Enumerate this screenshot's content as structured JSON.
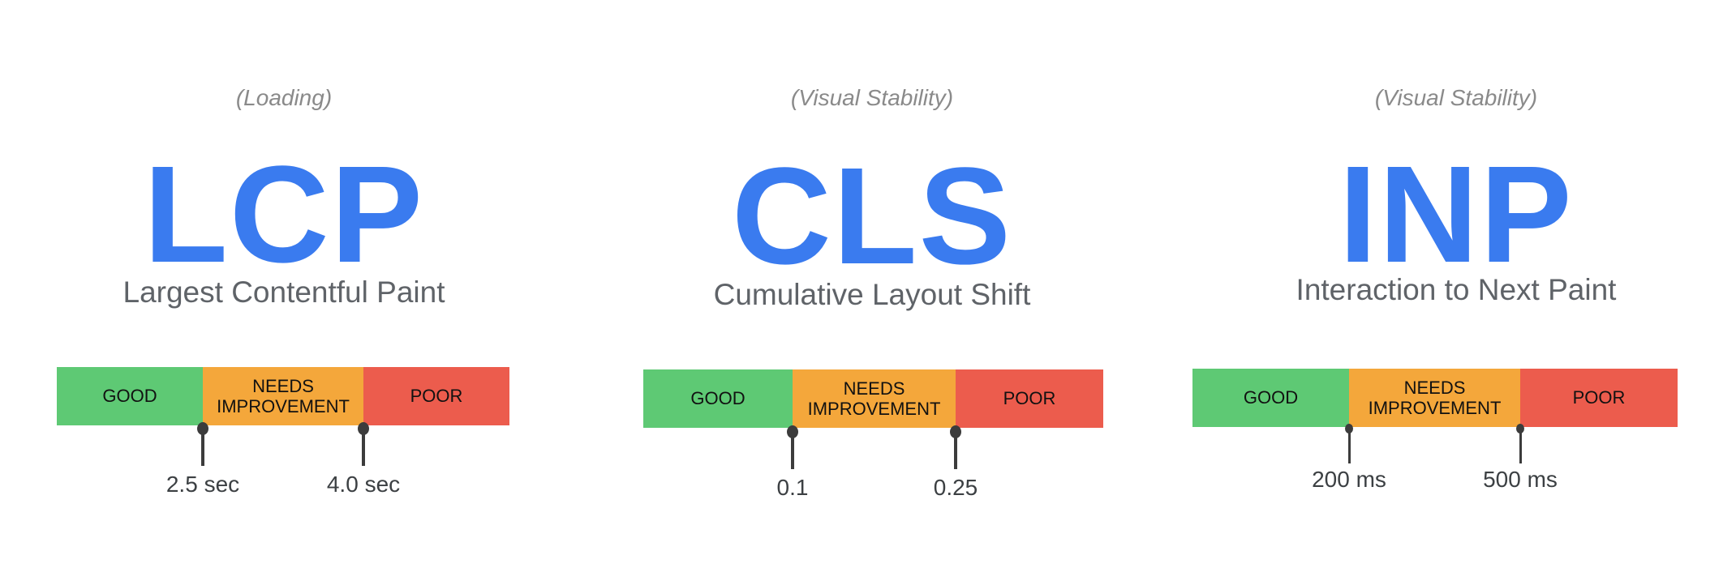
{
  "colors": {
    "accent": "#3a7bef",
    "good": "#5ec974",
    "needs_improvement": "#f4a73b",
    "poor": "#ec5c4d",
    "marker": "#3c3c3c",
    "category_text": "#8a8a8a",
    "name_text": "#5f6368"
  },
  "metrics": [
    {
      "category": "(Loading)",
      "acronym": "LCP",
      "name": "Largest Contentful Paint",
      "segments": [
        "GOOD",
        "NEEDS IMPROVEMENT",
        "POOR"
      ],
      "thresholds": [
        "2.5 sec",
        "4.0 sec"
      ]
    },
    {
      "category": "(Visual Stability)",
      "acronym": "CLS",
      "name": "Cumulative Layout Shift",
      "segments": [
        "GOOD",
        "NEEDS IMPROVEMENT",
        "POOR"
      ],
      "thresholds": [
        "0.1",
        "0.25"
      ]
    },
    {
      "category": "(Visual Stability)",
      "acronym": "INP",
      "name": "Interaction to Next Paint",
      "segments": [
        "GOOD",
        "NEEDS IMPROVEMENT",
        "POOR"
      ],
      "thresholds": [
        "200 ms",
        "500 ms"
      ]
    }
  ]
}
